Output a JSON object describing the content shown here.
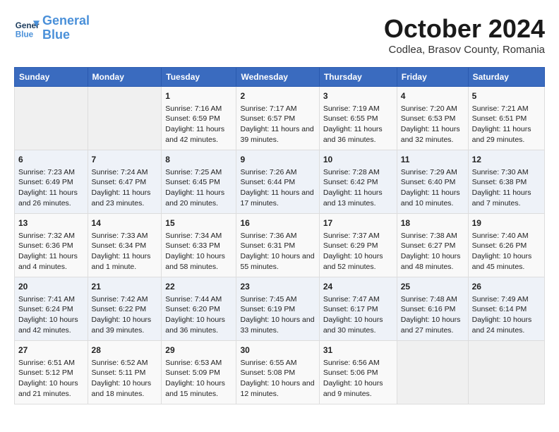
{
  "header": {
    "logo_line1": "General",
    "logo_line2": "Blue",
    "month": "October 2024",
    "location": "Codlea, Brasov County, Romania"
  },
  "days_of_week": [
    "Sunday",
    "Monday",
    "Tuesday",
    "Wednesday",
    "Thursday",
    "Friday",
    "Saturday"
  ],
  "weeks": [
    [
      {
        "day": "",
        "content": ""
      },
      {
        "day": "",
        "content": ""
      },
      {
        "day": "1",
        "content": "Sunrise: 7:16 AM\nSunset: 6:59 PM\nDaylight: 11 hours and 42 minutes."
      },
      {
        "day": "2",
        "content": "Sunrise: 7:17 AM\nSunset: 6:57 PM\nDaylight: 11 hours and 39 minutes."
      },
      {
        "day": "3",
        "content": "Sunrise: 7:19 AM\nSunset: 6:55 PM\nDaylight: 11 hours and 36 minutes."
      },
      {
        "day": "4",
        "content": "Sunrise: 7:20 AM\nSunset: 6:53 PM\nDaylight: 11 hours and 32 minutes."
      },
      {
        "day": "5",
        "content": "Sunrise: 7:21 AM\nSunset: 6:51 PM\nDaylight: 11 hours and 29 minutes."
      }
    ],
    [
      {
        "day": "6",
        "content": "Sunrise: 7:23 AM\nSunset: 6:49 PM\nDaylight: 11 hours and 26 minutes."
      },
      {
        "day": "7",
        "content": "Sunrise: 7:24 AM\nSunset: 6:47 PM\nDaylight: 11 hours and 23 minutes."
      },
      {
        "day": "8",
        "content": "Sunrise: 7:25 AM\nSunset: 6:45 PM\nDaylight: 11 hours and 20 minutes."
      },
      {
        "day": "9",
        "content": "Sunrise: 7:26 AM\nSunset: 6:44 PM\nDaylight: 11 hours and 17 minutes."
      },
      {
        "day": "10",
        "content": "Sunrise: 7:28 AM\nSunset: 6:42 PM\nDaylight: 11 hours and 13 minutes."
      },
      {
        "day": "11",
        "content": "Sunrise: 7:29 AM\nSunset: 6:40 PM\nDaylight: 11 hours and 10 minutes."
      },
      {
        "day": "12",
        "content": "Sunrise: 7:30 AM\nSunset: 6:38 PM\nDaylight: 11 hours and 7 minutes."
      }
    ],
    [
      {
        "day": "13",
        "content": "Sunrise: 7:32 AM\nSunset: 6:36 PM\nDaylight: 11 hours and 4 minutes."
      },
      {
        "day": "14",
        "content": "Sunrise: 7:33 AM\nSunset: 6:34 PM\nDaylight: 11 hours and 1 minute."
      },
      {
        "day": "15",
        "content": "Sunrise: 7:34 AM\nSunset: 6:33 PM\nDaylight: 10 hours and 58 minutes."
      },
      {
        "day": "16",
        "content": "Sunrise: 7:36 AM\nSunset: 6:31 PM\nDaylight: 10 hours and 55 minutes."
      },
      {
        "day": "17",
        "content": "Sunrise: 7:37 AM\nSunset: 6:29 PM\nDaylight: 10 hours and 52 minutes."
      },
      {
        "day": "18",
        "content": "Sunrise: 7:38 AM\nSunset: 6:27 PM\nDaylight: 10 hours and 48 minutes."
      },
      {
        "day": "19",
        "content": "Sunrise: 7:40 AM\nSunset: 6:26 PM\nDaylight: 10 hours and 45 minutes."
      }
    ],
    [
      {
        "day": "20",
        "content": "Sunrise: 7:41 AM\nSunset: 6:24 PM\nDaylight: 10 hours and 42 minutes."
      },
      {
        "day": "21",
        "content": "Sunrise: 7:42 AM\nSunset: 6:22 PM\nDaylight: 10 hours and 39 minutes."
      },
      {
        "day": "22",
        "content": "Sunrise: 7:44 AM\nSunset: 6:20 PM\nDaylight: 10 hours and 36 minutes."
      },
      {
        "day": "23",
        "content": "Sunrise: 7:45 AM\nSunset: 6:19 PM\nDaylight: 10 hours and 33 minutes."
      },
      {
        "day": "24",
        "content": "Sunrise: 7:47 AM\nSunset: 6:17 PM\nDaylight: 10 hours and 30 minutes."
      },
      {
        "day": "25",
        "content": "Sunrise: 7:48 AM\nSunset: 6:16 PM\nDaylight: 10 hours and 27 minutes."
      },
      {
        "day": "26",
        "content": "Sunrise: 7:49 AM\nSunset: 6:14 PM\nDaylight: 10 hours and 24 minutes."
      }
    ],
    [
      {
        "day": "27",
        "content": "Sunrise: 6:51 AM\nSunset: 5:12 PM\nDaylight: 10 hours and 21 minutes."
      },
      {
        "day": "28",
        "content": "Sunrise: 6:52 AM\nSunset: 5:11 PM\nDaylight: 10 hours and 18 minutes."
      },
      {
        "day": "29",
        "content": "Sunrise: 6:53 AM\nSunset: 5:09 PM\nDaylight: 10 hours and 15 minutes."
      },
      {
        "day": "30",
        "content": "Sunrise: 6:55 AM\nSunset: 5:08 PM\nDaylight: 10 hours and 12 minutes."
      },
      {
        "day": "31",
        "content": "Sunrise: 6:56 AM\nSunset: 5:06 PM\nDaylight: 10 hours and 9 minutes."
      },
      {
        "day": "",
        "content": ""
      },
      {
        "day": "",
        "content": ""
      }
    ]
  ]
}
